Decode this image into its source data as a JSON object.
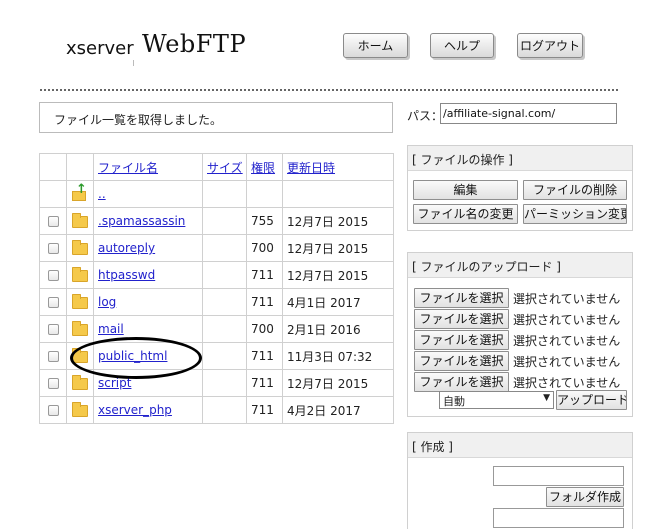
{
  "header": {
    "logo_small": "xserver",
    "logo_large": "WebFTP",
    "nav": {
      "home": "ホーム",
      "help": "ヘルプ",
      "logout": "ログアウト"
    }
  },
  "message": "ファイル一覧を取得しました。",
  "path": {
    "label": "パス：",
    "value": "/affiliate-signal.com/"
  },
  "table": {
    "columns": {
      "name": "ファイル名",
      "size": "サイズ",
      "perm": "権限",
      "date": "更新日時"
    },
    "parent": "..",
    "rows": [
      {
        "name": ".spamassassin",
        "perm": "755",
        "date": "12月7日 2015"
      },
      {
        "name": "autoreply",
        "perm": "700",
        "date": "12月7日 2015"
      },
      {
        "name": "htpasswd",
        "perm": "711",
        "date": "12月7日 2015"
      },
      {
        "name": "log",
        "perm": "711",
        "date": "4月1日 2017"
      },
      {
        "name": "mail",
        "perm": "700",
        "date": "2月1日 2016"
      },
      {
        "name": "public_html",
        "perm": "711",
        "date": "11月3日 07:32"
      },
      {
        "name": "script",
        "perm": "711",
        "date": "12月7日 2015"
      },
      {
        "name": "xserver_php",
        "perm": "711",
        "date": "4月2日 2017"
      }
    ]
  },
  "ops": {
    "title": "[ ファイルの操作 ]",
    "edit": "編集",
    "delete": "ファイルの削除",
    "rename": "ファイル名の変更",
    "permission": "パーミッション変更"
  },
  "upload": {
    "title": "[ ファイルのアップロード ]",
    "choose": "ファイルを選択",
    "no_file": "選択されていません",
    "mode": "自動",
    "submit": "アップロード"
  },
  "create": {
    "title": "[ 作成 ]",
    "folder_button": "フォルダ作成"
  },
  "icons": {
    "parent": "folder-up-icon",
    "folder": "folder-icon"
  },
  "annotation_color": "#000000"
}
